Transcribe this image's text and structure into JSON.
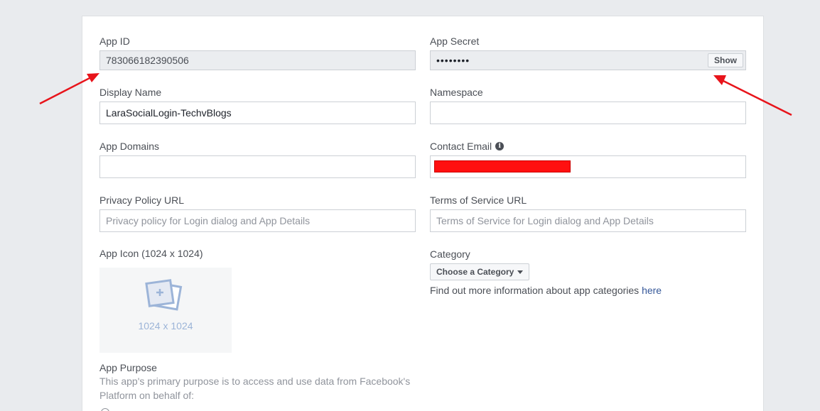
{
  "form": {
    "app_id": {
      "label": "App ID",
      "value": "783066182390506"
    },
    "app_secret": {
      "label": "App Secret",
      "value": "••••••••",
      "button_label": "Show"
    },
    "display_name": {
      "label": "Display Name",
      "value": "LaraSocialLogin-TechvBlogs"
    },
    "namespace": {
      "label": "Namespace",
      "value": ""
    },
    "app_domains": {
      "label": "App Domains",
      "value": ""
    },
    "contact_email": {
      "label": "Contact Email",
      "info_icon": "info-icon"
    },
    "privacy_policy_url": {
      "label": "Privacy Policy URL",
      "placeholder": "Privacy policy for Login dialog and App Details"
    },
    "terms_of_service_url": {
      "label": "Terms of Service URL",
      "placeholder": "Terms of Service for Login dialog and App Details"
    },
    "app_icon": {
      "label": "App Icon (1024 x 1024)",
      "size_text": "1024 x 1024",
      "icon": "image-add-icon"
    },
    "category": {
      "label": "Category",
      "button_label": "Choose a Category",
      "help_text": "Find out more information about app categories ",
      "help_link": "here"
    },
    "app_purpose": {
      "label": "App Purpose",
      "description": "This app's primary purpose is to access and use data from Facebook's Platform on behalf of:"
    }
  },
  "colors": {
    "annotation_arrow": "#e8141b",
    "redaction": "#ff1010",
    "link": "#365899"
  }
}
